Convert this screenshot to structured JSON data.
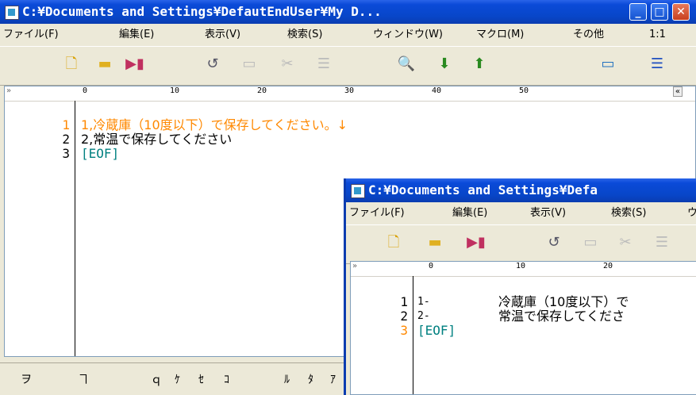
{
  "win1": {
    "title": "C:¥Documents and Settings¥DefautEndUser¥My D...",
    "menu": [
      "ファイル(F)",
      "編集(E)",
      "表示(V)",
      "検索(S)",
      "ウィンドウ(W)",
      "マクロ(M)",
      "その他",
      "1:1"
    ],
    "ruler_marks": [
      "0",
      "10",
      "20",
      "30",
      "40",
      "50"
    ],
    "lines": [
      {
        "num": "1",
        "text": "1,冷蔵庫（10度以下）で保存してください。↓",
        "color": "#ff8800"
      },
      {
        "num": "2",
        "text": "2,常温で保存してください"
      },
      {
        "num": "3",
        "text": "[EOF]",
        "color": "#008080"
      }
    ],
    "status": [
      "ヲ",
      "ヿ",
      "ｑ",
      "ｹ",
      "ｾ",
      "ｺ",
      "ﾙ",
      "ﾀ",
      "ｱ"
    ]
  },
  "win2": {
    "title": "C:¥Documents and Settings¥Defa",
    "menu": [
      "ファイル(F)",
      "編集(E)",
      "表示(V)",
      "検索(S)",
      "ウ"
    ],
    "ruler_marks": [
      "0",
      "10",
      "20"
    ],
    "lines": [
      {
        "num": "1",
        "prefix": "1-",
        "text": "冷蔵庫（10度以下）で"
      },
      {
        "num": "2",
        "prefix": "2-",
        "text": "常温で保存してくださ"
      },
      {
        "num": "3",
        "text": "[EOF]",
        "color": "#008080"
      }
    ]
  },
  "ui": {
    "ruler_chev": "»",
    "ruler_side1": "«",
    "ruler_side2": "≡"
  }
}
